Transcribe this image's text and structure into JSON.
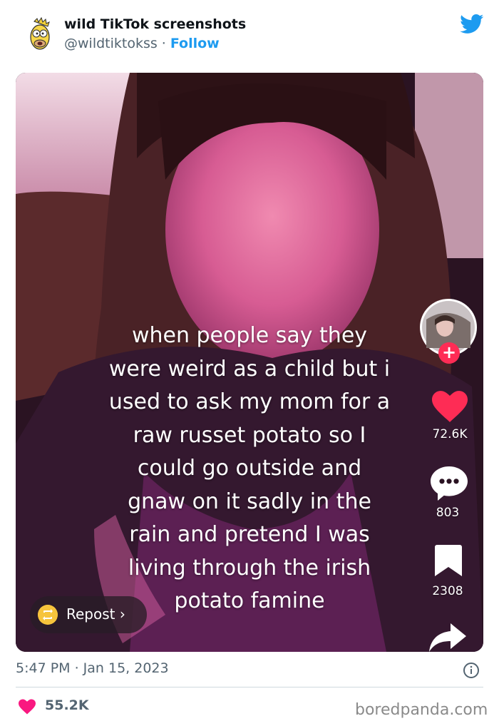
{
  "tweet": {
    "account_name": "wild TikTok screenshots",
    "handle": "@wildtiktokss",
    "separator": "·",
    "follow_label": "Follow",
    "timestamp": "5:47 PM · Jan 15, 2023",
    "like_count": "55.2K"
  },
  "video": {
    "caption_lines": [
      "when people say they",
      "were weird as a child but i",
      "used to ask my mom for a",
      "raw russet potato so I",
      "could go outside and",
      "gnaw on it sadly in the",
      "rain and pretend I was",
      "living through the irish",
      "potato famine"
    ],
    "likes": "72.6K",
    "comments": "803",
    "saves": "2308",
    "follow_plus": "+",
    "repost_label": "Repost ›"
  },
  "watermark": "boredpanda.com",
  "icons": {
    "twitter": "twitter-bird-icon",
    "info": "info-icon",
    "like": "heart-icon",
    "tt_like": "heart-icon",
    "tt_comment": "comment-bubble-icon",
    "tt_save": "bookmark-icon",
    "tt_share": "share-arrow-icon",
    "repost": "repost-icon"
  },
  "colors": {
    "twitter_blue": "#1d9bf0",
    "tiktok_red": "#fe2c55",
    "like_pink": "#f91880",
    "repost_yellow": "#f6c43c",
    "muted_text": "#536471"
  }
}
